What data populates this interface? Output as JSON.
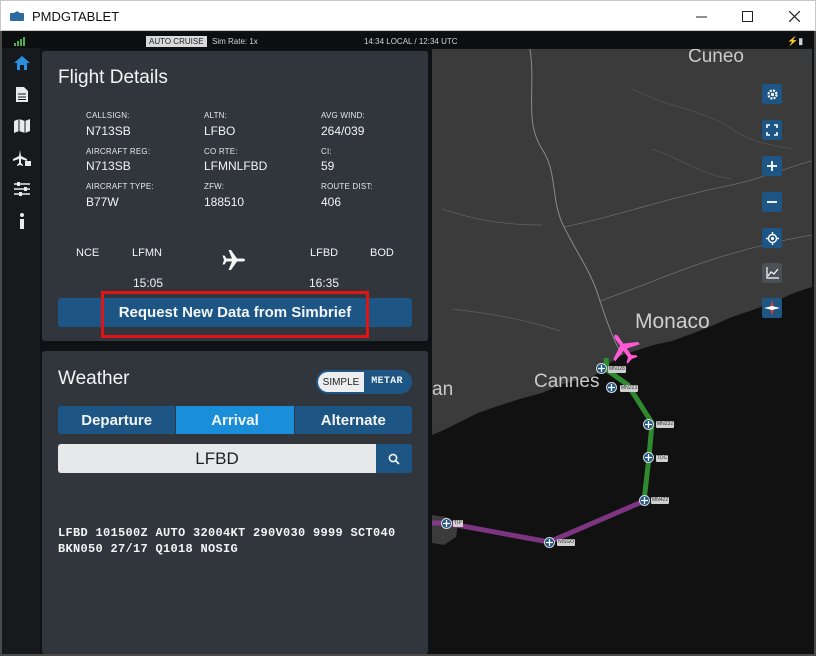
{
  "window": {
    "title": "PMDGTABLET"
  },
  "status": {
    "mode": "AUTO CRUISE",
    "sim_rate": "Sim Rate: 1x",
    "clock": "14:34 LOCAL / 12:34 UTC"
  },
  "nav": {
    "items": [
      "home-icon",
      "document-icon",
      "map-icon",
      "aircraft-settings-icon",
      "sliders-icon",
      "info-icon"
    ]
  },
  "flight": {
    "title": "Flight Details",
    "callsign_label": "CALLSIGN:",
    "callsign": "N713SB",
    "altn_label": "ALTN:",
    "altn": "LFBO",
    "wind_label": "AVG WIND:",
    "wind": "264/039",
    "reg_label": "AIRCRAFT REG:",
    "reg": "N713SB",
    "corte_label": "CO RTE:",
    "corte": "LFMNLFBD",
    "ci_label": "CI:",
    "ci": "59",
    "type_label": "AIRCRAFT TYPE:",
    "type": "B77W",
    "zfw_label": "ZFW:",
    "zfw": "188510",
    "dist_label": "ROUTE DIST:",
    "dist": "406",
    "dep_iata": "NCE",
    "dep_icao": "LFMN",
    "dep_time": "15:05",
    "arr_icao": "LFBD",
    "arr_iata": "BOD",
    "arr_time": "16:35",
    "request_label": "Request New Data from Simbrief"
  },
  "weather": {
    "title": "Weather",
    "toggle_simple": "SIMPLE",
    "toggle_metar": "METAR",
    "tabs": [
      "Departure",
      "Arrival",
      "Alternate"
    ],
    "icao": "LFBD",
    "metar": "LFBD 101500Z AUTO 32004KT 290V030 9999 SCT040 BKN050 27/17 Q1018 NOSIG"
  },
  "map": {
    "cities": [
      "Cuneo",
      "Monaco",
      "Cannes",
      "an"
    ],
    "waypoints": [
      "MNJ28",
      "MN223",
      "MN232",
      "TDC",
      "MN422",
      "NISGO",
      "TIP"
    ],
    "controls": [
      "settings-icon",
      "fullscreen-icon",
      "zoom-in-icon",
      "zoom-out-icon",
      "locate-icon",
      "chart-icon",
      "compass-icon"
    ]
  }
}
